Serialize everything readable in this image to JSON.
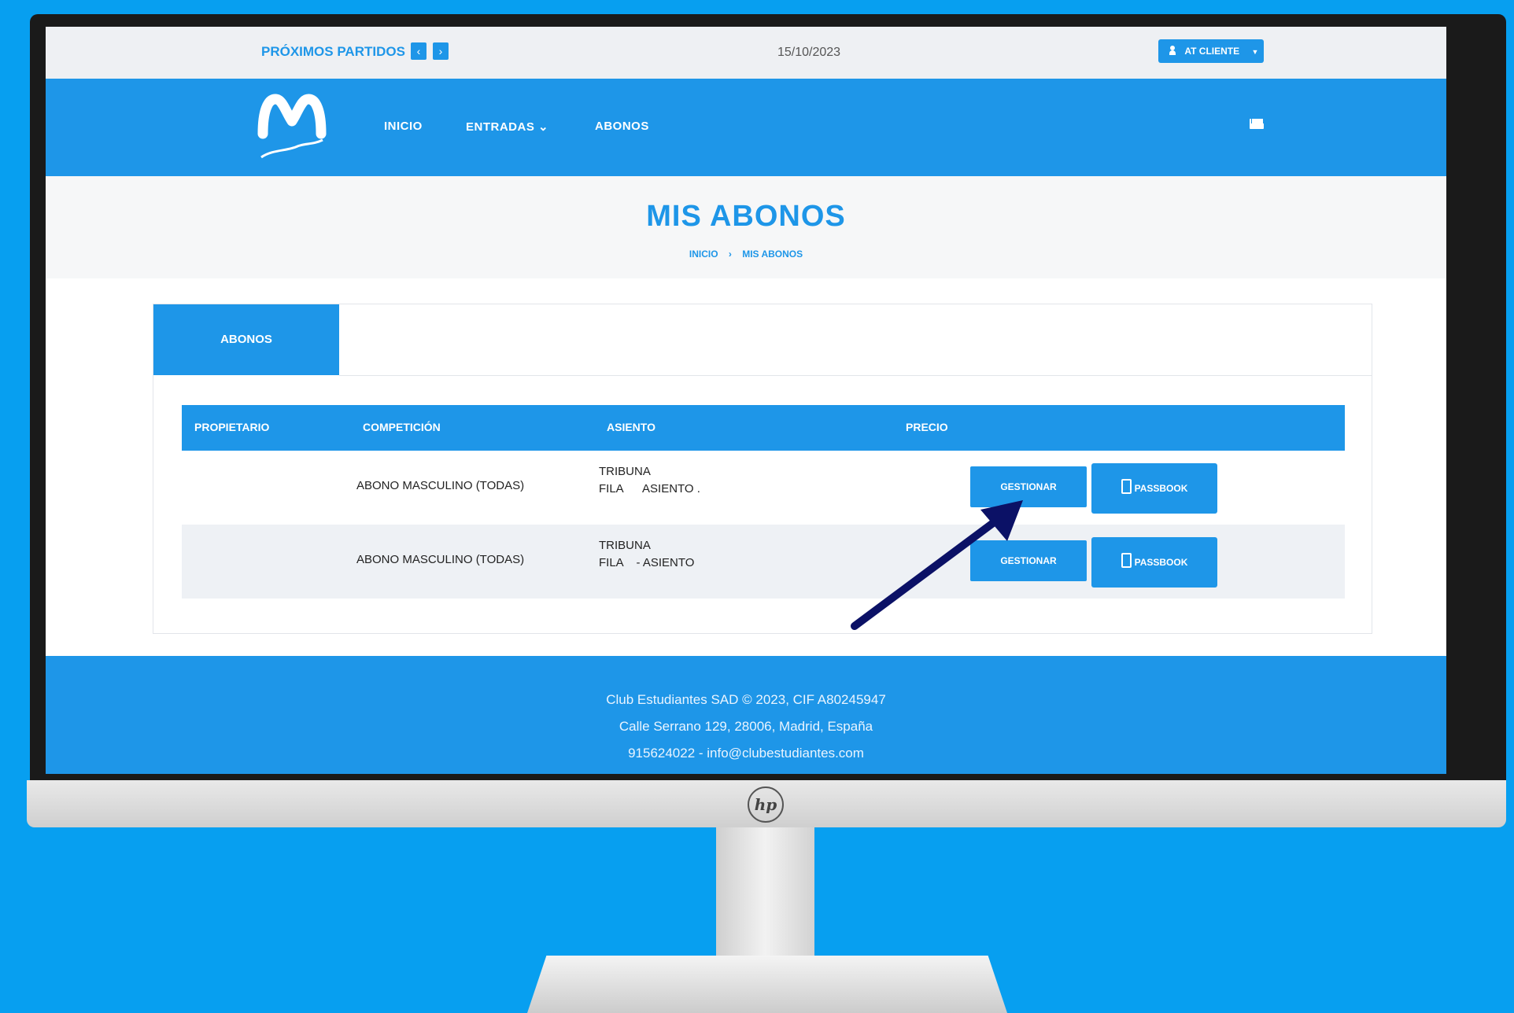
{
  "topbar": {
    "next_matches_label": "PRÓXIMOS PARTIDOS",
    "prev_glyph": "‹",
    "next_glyph": "›",
    "date": "15/10/2023",
    "client_button_label": "AT CLIENTE"
  },
  "navbar": {
    "logo_alt": "Estudiantes",
    "items": [
      {
        "label": "INICIO"
      },
      {
        "label": "ENTRADAS ⌄"
      },
      {
        "label": "ABONOS"
      }
    ]
  },
  "page": {
    "title": "MIS ABONOS",
    "breadcrumb": [
      "INICIO",
      "MIS ABONOS"
    ],
    "breadcrumb_sep": "›"
  },
  "tabs": [
    {
      "label": "ABONOS"
    }
  ],
  "table": {
    "headers": [
      "PROPIETARIO",
      "COMPETICIÓN",
      "ASIENTO",
      "PRECIO"
    ],
    "rows": [
      {
        "owner": "",
        "competition": "ABONO MASCULINO (TODAS)",
        "seat_line1": "TRIBUNA",
        "seat_line2": "FILA      ASIENTO .",
        "price": "",
        "manage_label": "GESTIONAR",
        "passbook_label": "PASSBOOK"
      },
      {
        "owner": "",
        "competition": "ABONO MASCULINO (TODAS)",
        "seat_line1": "TRIBUNA",
        "seat_line2": "FILA    - ASIENTO",
        "price": "",
        "manage_label": "GESTIONAR",
        "passbook_label": "PASSBOOK"
      }
    ]
  },
  "footer": {
    "line1": "Club Estudiantes SAD © 2023, CIF A80245947",
    "line2": "Calle Serrano 129, 28006, Madrid, España",
    "line3": "915624022 - info@clubestudiantes.com"
  },
  "monitor": {
    "brand": "hp"
  },
  "colors": {
    "background": "#079ff0",
    "primary": "#1e96e8",
    "arrow": "#0b1166"
  }
}
